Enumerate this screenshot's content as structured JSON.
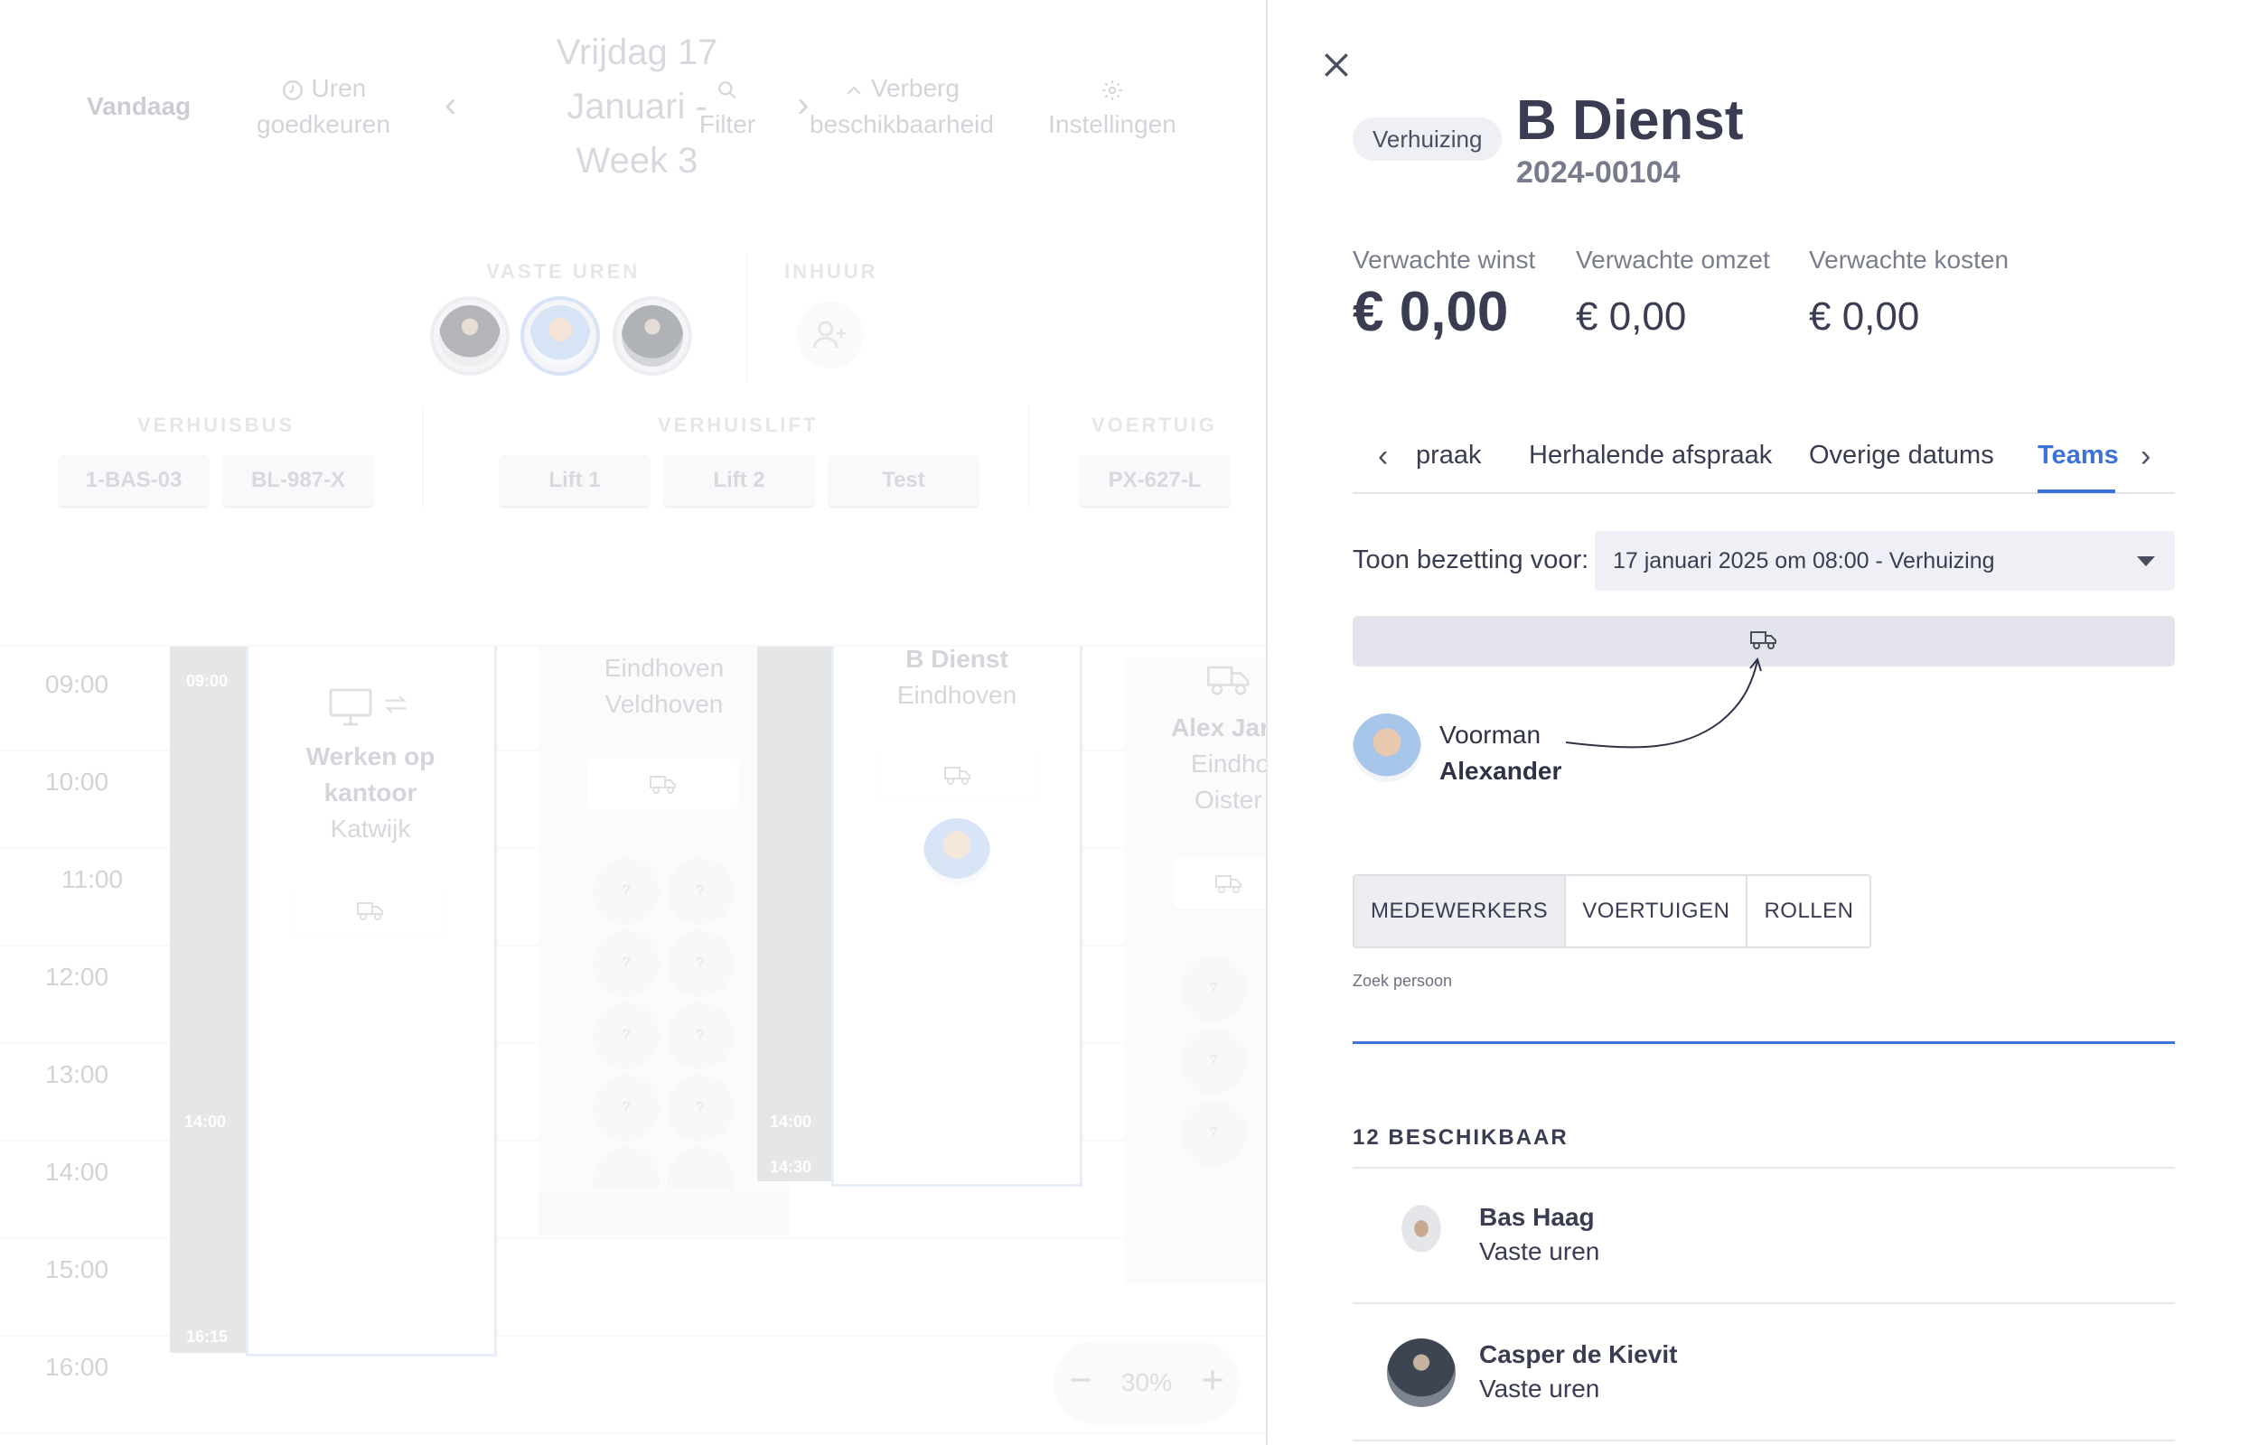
{
  "toolbar": {
    "today": "Vandaag",
    "approve_hours": "Uren goedkeuren",
    "date": "Vrijdag 17 Januari - Week 3",
    "filter": "Filter",
    "hide_availability": "Verberg beschikbaarheid",
    "settings": "Instellingen"
  },
  "resources": {
    "fixed_hours_label": "VASTE UREN",
    "hire_label": "INHUUR",
    "bus_label": "VERHUISBUS",
    "lift_label": "VERHUISLIFT",
    "vehicle_label": "VOERTUIG",
    "buses": [
      "1-BAS-03",
      "BL-987-X"
    ],
    "lifts": [
      "Lift 1",
      "Lift 2",
      "Test"
    ],
    "vehicles": [
      "PX-627-L"
    ]
  },
  "schedule": {
    "hours": [
      "09:00",
      "10:00",
      "11:00",
      "12:00",
      "13:00",
      "14:00",
      "15:00",
      "16:00"
    ],
    "col1": {
      "start": "09:00",
      "mid": "14:00",
      "end": "16:15",
      "title": "Werken op kantoor",
      "location": "Katwijk"
    },
    "col2": {
      "line1": "Eindhoven",
      "line2": "Veldhoven"
    },
    "col3": {
      "mid": "14:00",
      "end": "14:30",
      "title": "B Dienst",
      "location": "Eindhoven"
    },
    "col4": {
      "title": "Alex Jar",
      "line1": "Eindho",
      "line2": "Oister"
    },
    "zoom": "30%"
  },
  "detail": {
    "type_badge": "Verhuizing",
    "title": "B Dienst",
    "number": "2024-00104",
    "finance": {
      "profit_label": "Verwachte winst",
      "profit_value": "€ 0,00",
      "revenue_label": "Verwachte omzet",
      "revenue_value": "€ 0,00",
      "costs_label": "Verwachte kosten",
      "costs_value": "€ 0,00"
    },
    "tabs": [
      "praak",
      "Herhalende afspraak",
      "Overige datums",
      "Teams"
    ],
    "active_tab": "Teams",
    "occupancy_label": "Toon bezetting voor:",
    "occupancy_value": "17 januari 2025 om 08:00 - Verhuizing",
    "foreman_role": "Voorman",
    "foreman_name": "Alexander",
    "segments": [
      "MEDEWERKERS",
      "VOERTUIGEN",
      "ROLLEN"
    ],
    "search_label": "Zoek persoon",
    "search_value": "",
    "available_title": "12 BESCHIKBAAR",
    "people": [
      {
        "name": "Bas Haag",
        "sub": "Vaste uren"
      },
      {
        "name": "Casper de Kievit",
        "sub": "Vaste uren"
      }
    ]
  },
  "colors": {
    "accent": "#3d72d6",
    "card_border": "#c9d7f2",
    "time_column": "#c5c7cc"
  }
}
